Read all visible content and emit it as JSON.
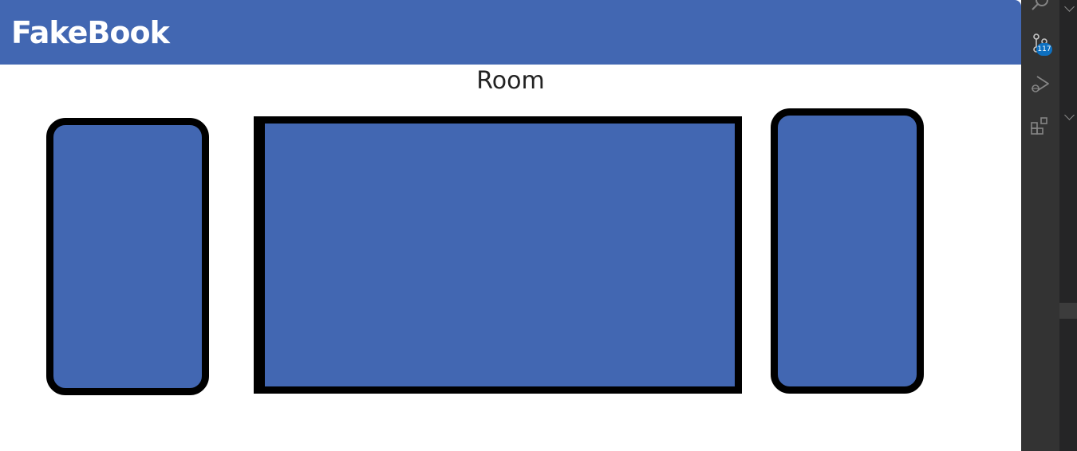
{
  "app": {
    "brand": "FakeBook",
    "room_title": "Room"
  },
  "colors": {
    "brand_blue": "#4267b2",
    "border": "#000000",
    "activity_bar": "#333333",
    "badge": "#0e70c0"
  },
  "activity_bar": {
    "icons": [
      "search-icon",
      "source-control-icon",
      "run-debug-icon",
      "extensions-icon"
    ],
    "source_control_badge": "117"
  }
}
